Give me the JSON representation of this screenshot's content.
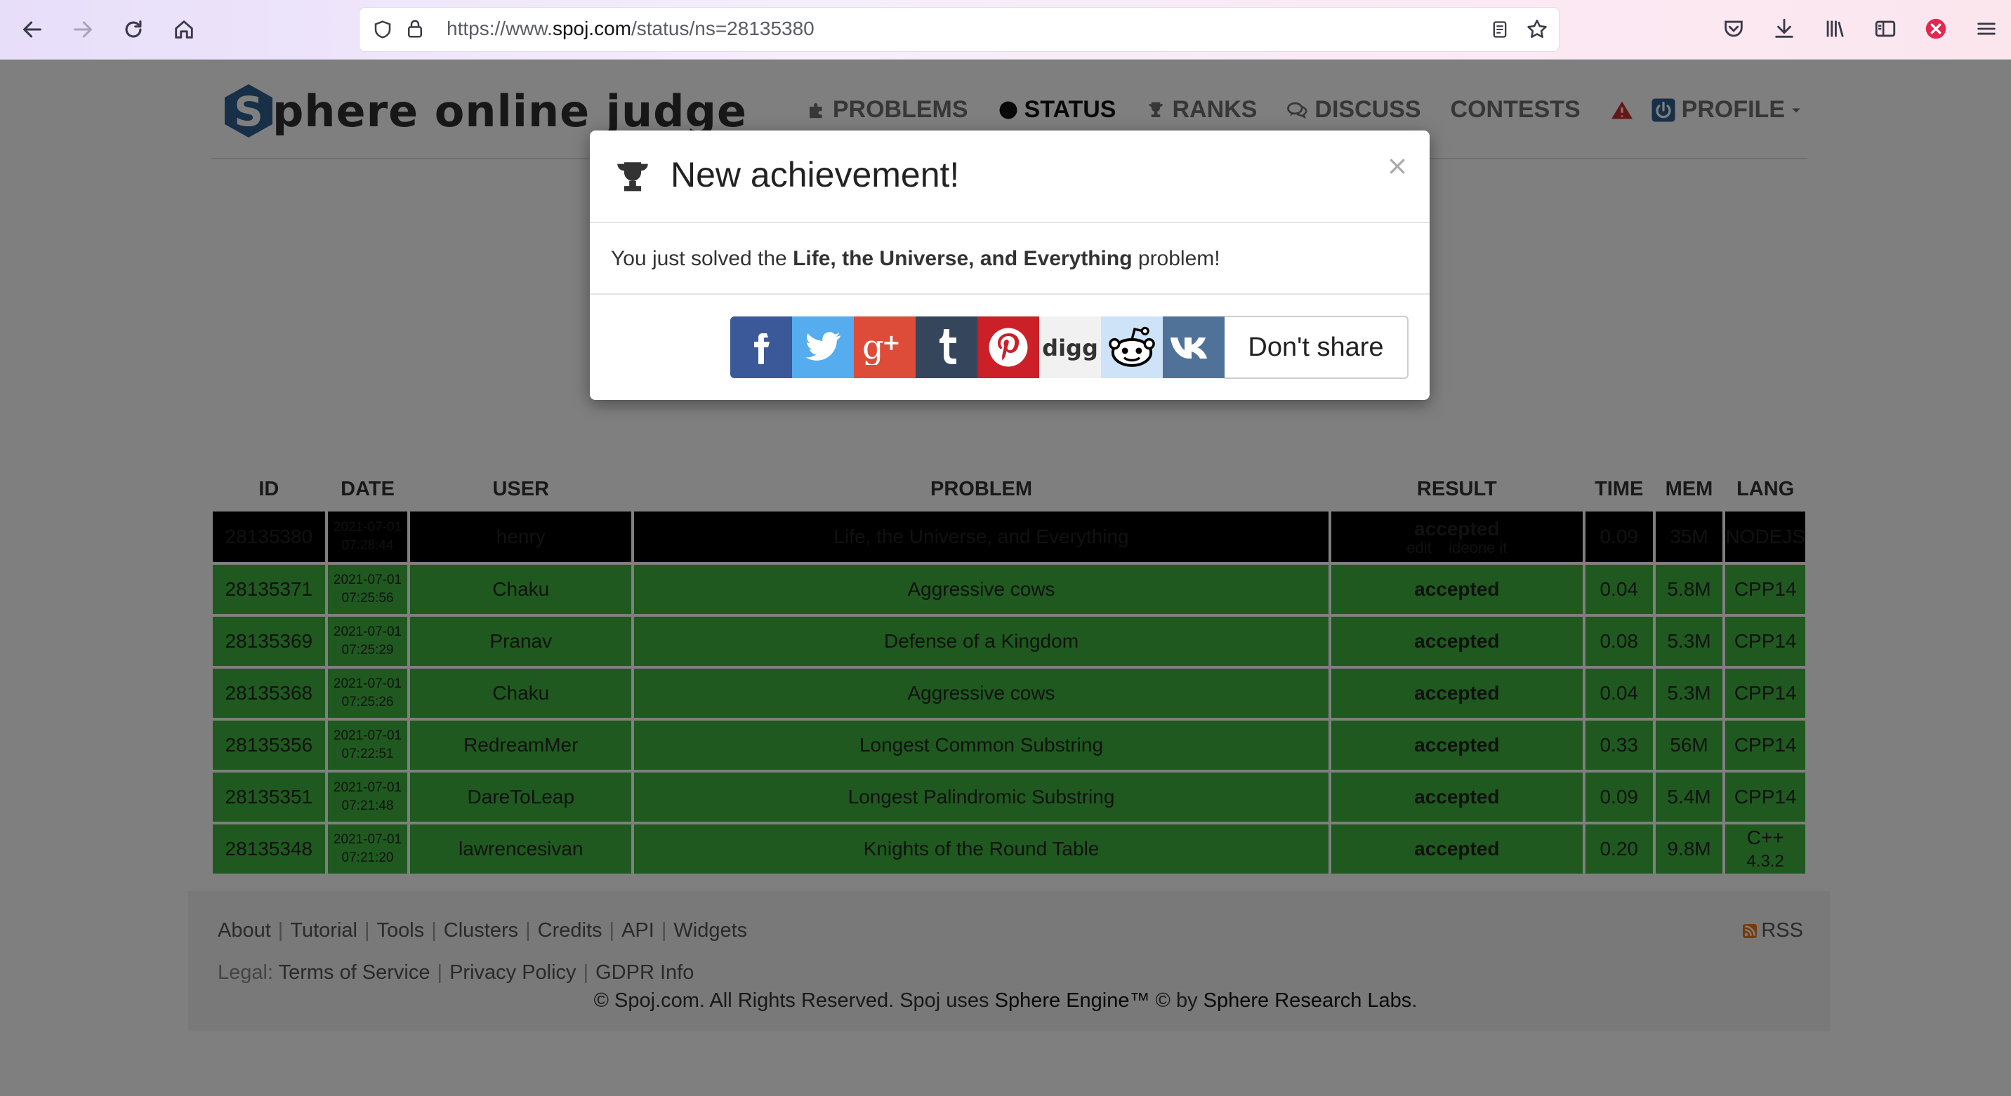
{
  "browser": {
    "url_prefix": "https://www.",
    "url_domain": "spoj.com",
    "url_path": "/status/ns=28135380"
  },
  "site": {
    "logo_letter": "S",
    "logo_rest": "phere online judge",
    "nav": {
      "problems": "PROBLEMS",
      "status": "STATUS",
      "ranks": "RANKS",
      "discuss": "DISCUSS",
      "contests": "CONTESTS",
      "profile": "PROFILE"
    }
  },
  "table": {
    "headers": [
      "ID",
      "DATE",
      "USER",
      "PROBLEM",
      "RESULT",
      "TIME",
      "MEM",
      "LANG"
    ],
    "rows": [
      {
        "id": "28135380",
        "date1": "2021-07-01",
        "date2": "07:28:44",
        "user": "henry",
        "problem": "Life, the Universe, and Everything",
        "result": "accepted",
        "time": "0.09",
        "mem": "35M",
        "lang1": "NODEJS",
        "lang2": ""
      },
      {
        "id": "28135371",
        "date1": "2021-07-01",
        "date2": "07:25:56",
        "user": "Chaku",
        "problem": "Aggressive cows",
        "result": "accepted",
        "time": "0.04",
        "mem": "5.8M",
        "lang1": "CPP14",
        "lang2": ""
      },
      {
        "id": "28135369",
        "date1": "2021-07-01",
        "date2": "07:25:29",
        "user": "Pranav",
        "problem": "Defense of a Kingdom",
        "result": "accepted",
        "time": "0.08",
        "mem": "5.3M",
        "lang1": "CPP14",
        "lang2": ""
      },
      {
        "id": "28135368",
        "date1": "2021-07-01",
        "date2": "07:25:26",
        "user": "Chaku",
        "problem": "Aggressive cows",
        "result": "accepted",
        "time": "0.04",
        "mem": "5.3M",
        "lang1": "CPP14",
        "lang2": ""
      },
      {
        "id": "28135356",
        "date1": "2021-07-01",
        "date2": "07:22:51",
        "user": "RedreamMer",
        "problem": "Longest Common Substring",
        "result": "accepted",
        "time": "0.33",
        "mem": "56M",
        "lang1": "CPP14",
        "lang2": ""
      },
      {
        "id": "28135351",
        "date1": "2021-07-01",
        "date2": "07:21:48",
        "user": "DareToLeap",
        "problem": "Longest Palindromic Substring",
        "result": "accepted",
        "time": "0.09",
        "mem": "5.4M",
        "lang1": "CPP14",
        "lang2": ""
      },
      {
        "id": "28135348",
        "date1": "2021-07-01",
        "date2": "07:21:20",
        "user": "lawrencesivan",
        "problem": "Knights of the Round Table",
        "result": "accepted",
        "time": "0.20",
        "mem": "9.8M",
        "lang1": "C++",
        "lang2": "4.3.2"
      }
    ],
    "own_row_links": {
      "edit": "edit",
      "ideone": "ideone it"
    }
  },
  "footer": {
    "links": [
      "About",
      "Tutorial",
      "Tools",
      "Clusters",
      "Credits",
      "API",
      "Widgets"
    ],
    "legal_label": "Legal:",
    "legal_links": [
      "Terms of Service",
      "Privacy Policy",
      "GDPR Info"
    ],
    "rss": "RSS",
    "copyright_pre": "© Spoj.com. All Rights Reserved. Spoj uses ",
    "copyright_engine": "Sphere Engine™",
    "copyright_mid": " © by ",
    "copyright_labs": "Sphere Research Labs",
    "copyright_end": "."
  },
  "modal": {
    "title": "New achievement!",
    "close": "×",
    "body_pre": "You just solved the ",
    "body_problem": "Life, the Universe, and Everything",
    "body_post": " problem!",
    "dont_share": "Don't share",
    "share_buttons": [
      "facebook",
      "twitter",
      "google-plus",
      "tumblr",
      "pinterest",
      "digg",
      "reddit",
      "vk"
    ]
  },
  "colors": {
    "accepted_row": "#3fb33f",
    "own_row": "#000000",
    "logo_hex": "#2e5f8f"
  }
}
